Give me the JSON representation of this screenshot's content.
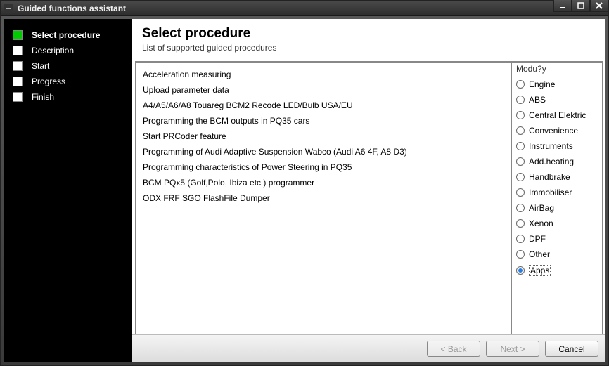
{
  "window": {
    "title": "Guided functions assistant"
  },
  "sidebar": {
    "steps": [
      {
        "label": "Select procedure",
        "active": true
      },
      {
        "label": "Description",
        "active": false
      },
      {
        "label": "Start",
        "active": false
      },
      {
        "label": "Progress",
        "active": false
      },
      {
        "label": "Finish",
        "active": false
      }
    ]
  },
  "main": {
    "title": "Select procedure",
    "subtitle": "List of supported guided procedures"
  },
  "procedures": [
    "Acceleration measuring",
    "Upload parameter data",
    "A4/A5/A6/A8 Touareg BCM2 Recode LED/Bulb USA/EU",
    "Programming the BCM outputs in PQ35 cars",
    "Start PRCoder feature",
    "Programming of Audi Adaptive Suspension Wabco (Audi A6 4F, A8 D3)",
    "Programming characteristics of Power Steering in PQ35",
    "BCM PQx5 (Golf,Polo, Ibiza etc ) programmer",
    "ODX FRF SGO FlashFile Dumper"
  ],
  "modules": {
    "group_label": "Modu?y",
    "options": [
      {
        "label": "Engine",
        "checked": false
      },
      {
        "label": "ABS",
        "checked": false
      },
      {
        "label": "Central Elektric",
        "checked": false
      },
      {
        "label": "Convenience",
        "checked": false
      },
      {
        "label": "Instruments",
        "checked": false
      },
      {
        "label": "Add.heating",
        "checked": false
      },
      {
        "label": "Handbrake",
        "checked": false
      },
      {
        "label": "Immobiliser",
        "checked": false
      },
      {
        "label": "AirBag",
        "checked": false
      },
      {
        "label": "Xenon",
        "checked": false
      },
      {
        "label": "DPF",
        "checked": false
      },
      {
        "label": "Other",
        "checked": false
      },
      {
        "label": "Apps",
        "checked": true
      }
    ]
  },
  "footer": {
    "back": "< Back",
    "next": "Next >",
    "cancel": "Cancel"
  }
}
